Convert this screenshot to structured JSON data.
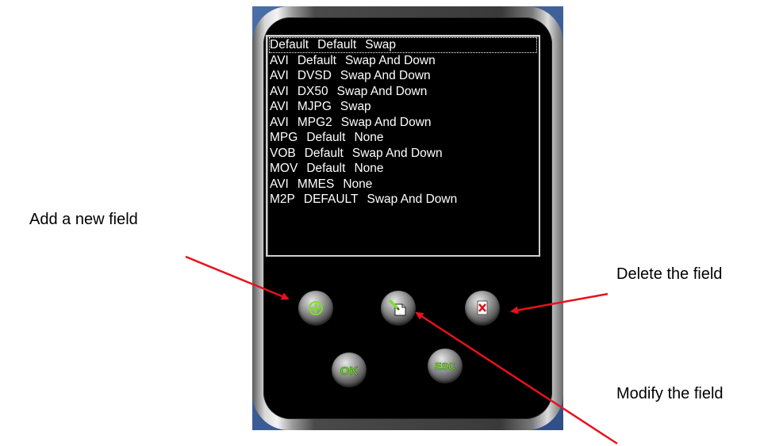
{
  "list": {
    "rows": [
      [
        "Default",
        "Default",
        "Swap"
      ],
      [
        "AVI",
        "Default",
        "Swap And Down"
      ],
      [
        "AVI",
        "DVSD",
        "Swap And Down"
      ],
      [
        "AVI",
        "DX50",
        "Swap And Down"
      ],
      [
        "AVI",
        "MJPG",
        "Swap"
      ],
      [
        "AVI",
        "MPG2",
        "Swap And Down"
      ],
      [
        "MPG",
        "Default",
        "None"
      ],
      [
        "VOB",
        "Default",
        "Swap And Down"
      ],
      [
        "MOV",
        "Default",
        "None"
      ],
      [
        "AVI",
        "MMES",
        "None"
      ],
      [
        "M2P",
        "DEFAULT",
        "Swap And Down"
      ]
    ]
  },
  "buttons": {
    "ok_label": "OK",
    "esc_label": "ESC"
  },
  "icons": {
    "add": "plus-icon",
    "modify": "edit-icon",
    "delete": "delete-icon"
  },
  "annotations": {
    "add": "Add a new field",
    "delete": "Delete the field",
    "modify": "Modify the field"
  },
  "colors": {
    "frame_corner": "#3a5a94",
    "arrow": "#e8121c",
    "green_glyph": "#7dde2a",
    "delete_glyph": "#d8171f"
  }
}
